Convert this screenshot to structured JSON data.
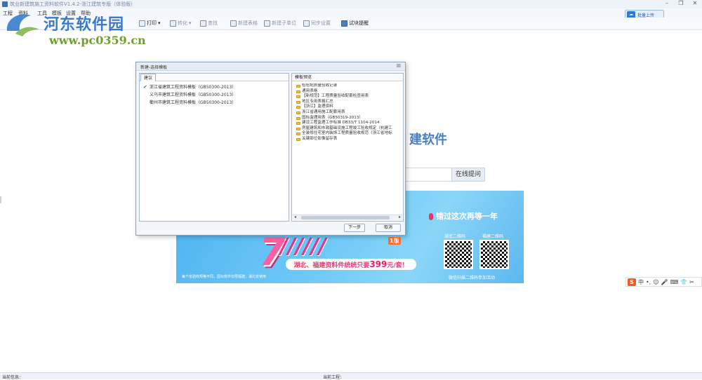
{
  "window": {
    "title": "筑业新建筑施工资料软件V1.4.2-浙江建筑专版（体验版）",
    "controls": [
      "–",
      "❐",
      "✕"
    ]
  },
  "menu": [
    "工程",
    "资料",
    "工具",
    "模板",
    "设置",
    "帮助"
  ],
  "upload_button": "批量上传",
  "toolbar": [
    {
      "label": "打印",
      "icon": "printer-icon",
      "dropdown": true
    },
    {
      "label": "转化",
      "icon": "convert-icon",
      "dropdown": true
    },
    {
      "label": "查找",
      "icon": "search-icon"
    },
    {
      "label": "新建表格",
      "icon": "new-table-icon"
    },
    {
      "label": "新建子单位",
      "icon": "new-subunit-icon"
    },
    {
      "label": "同步设置",
      "icon": "sync-icon"
    },
    {
      "label": "试块提醒",
      "icon": "reminder-icon"
    }
  ],
  "watermark": {
    "text": "河东软件园",
    "url": "www.pc0359.cn"
  },
  "background": {
    "heading_fragment": "建软件",
    "search_button": "在线提问"
  },
  "banner": {
    "big_text": "7",
    "edition": "1版",
    "promo_text": "湖北、福建资料件统统只要",
    "promo_price": "399",
    "promo_suffix": "元/套！",
    "slogan": "错过这次再等一年",
    "qr_left_label": "湖北二维码",
    "qr_right_label": "福建二维码",
    "qr_caption": "微信扫描二维码参加活动",
    "footnote": "每个省验收规格不同，国标软件仅限福建，湖北省使用"
  },
  "ime_bar": {
    "logo": "S",
    "items": [
      "中",
      "•,",
      "☺",
      "🎤",
      "⌨",
      "👕",
      "✂"
    ]
  },
  "status": {
    "left_label": "当前信息：",
    "right_label": "当前工程："
  },
  "dialog": {
    "title": "新建-选择模板",
    "close": "☒",
    "left_tab": "建议",
    "right_header": "模板预览",
    "templates": [
      {
        "label": "浙江省建筑工程资料模板（GB50300-2013）",
        "checked": true
      },
      {
        "label": "义乌市建筑工程资料模板（GB50300-2013）",
        "checked": false
      },
      {
        "label": "衢州市建筑工程资料模板（GB50300-2013）",
        "checked": false
      }
    ],
    "preview_items": [
      "检验批质量验收记录",
      "通用表格",
      "【新规范】工程质量验收配套检查用表",
      "地区专用表格汇总",
      "【浙江】监理资料",
      "浙江省通用施工配套用表",
      "国标监理用表（GB50319-2013）",
      "建设工程监理工作标准 DB33/T 1104-2014",
      "房屋建筑和市政基础设施工程竣工验收规定（杭建工",
      "全装修住宅室内装饰工程质量验收规范（浙江省地标",
      "关键部位影像留存表"
    ],
    "next_button": "下一步",
    "cancel_button": "取消"
  }
}
